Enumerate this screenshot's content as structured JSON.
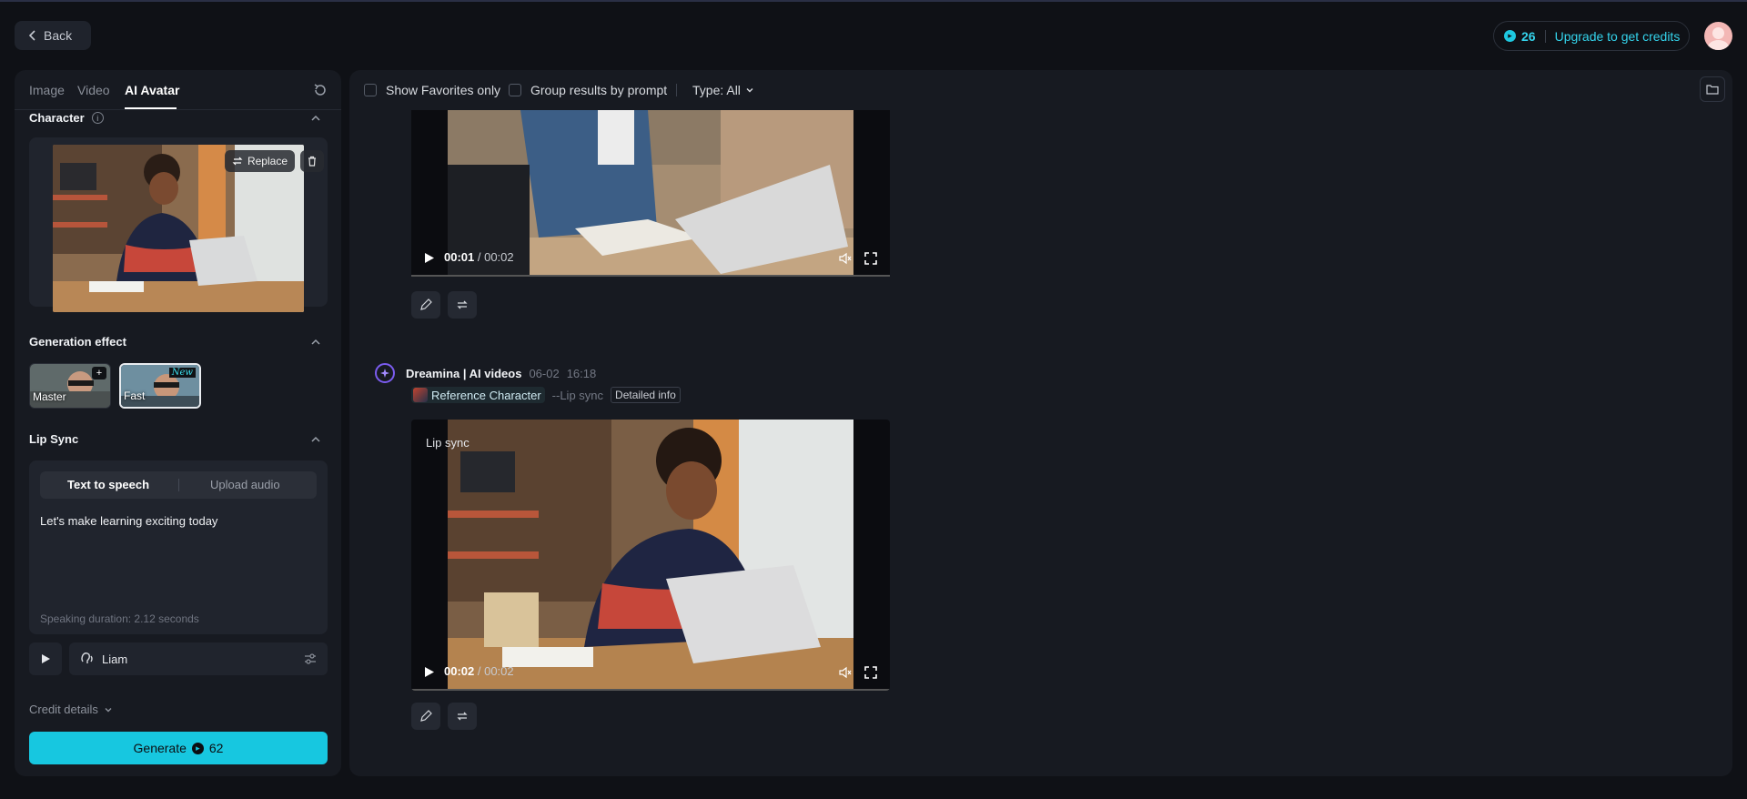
{
  "header": {
    "back_label": "Back",
    "credits": "26",
    "upgrade_label": "Upgrade to get credits"
  },
  "left": {
    "tabs": [
      {
        "label": "Image"
      },
      {
        "label": "Video"
      },
      {
        "label": "AI Avatar",
        "active": true
      }
    ],
    "character": {
      "title": "Character",
      "replace_label": "Replace"
    },
    "generation_effect": {
      "title": "Generation effect",
      "options": [
        {
          "label": "Master",
          "badge": "+"
        },
        {
          "label": "Fast",
          "badge": "New",
          "selected": true
        }
      ]
    },
    "lip_sync": {
      "title": "Lip Sync",
      "tabs": [
        "Text to speech",
        "Upload audio"
      ],
      "active_tab": "Text to speech",
      "text": "Let's make learning exciting today",
      "duration": "Speaking duration: 2.12 seconds"
    },
    "voice": {
      "name": "Liam"
    },
    "credit_details_label": "Credit details",
    "generate": {
      "label": "Generate",
      "cost": "62"
    }
  },
  "main": {
    "filters": {
      "favorites_label": "Show Favorites only",
      "group_label": "Group results by prompt",
      "type_label": "Type: All"
    },
    "videos": [
      {
        "current": "00:01",
        "duration": "/ 00:02"
      },
      {
        "app_name": "Dreamina | AI videos",
        "date": "06-02",
        "time": "16:18",
        "reference_label": "Reference Character",
        "mode": "--Lip sync",
        "detail_label": "Detailed info",
        "overlay_label": "Lip sync",
        "current": "00:02",
        "duration": "/ 00:02"
      }
    ]
  },
  "colors": {
    "accent": "#17c7e0",
    "background": "#0f1116",
    "panel": "#171a21",
    "brand_purple": "#7b5cf0"
  },
  "icons": [
    "chevron-left-icon",
    "credit-icon",
    "reset-icon",
    "info-icon",
    "chevron-up-icon",
    "replace-icon",
    "trash-icon",
    "play-icon",
    "voice-icon",
    "settings-sliders-icon",
    "chevron-down-icon",
    "folder-icon",
    "volume-icon",
    "fullscreen-icon",
    "edit-icon",
    "regenerate-icon"
  ]
}
